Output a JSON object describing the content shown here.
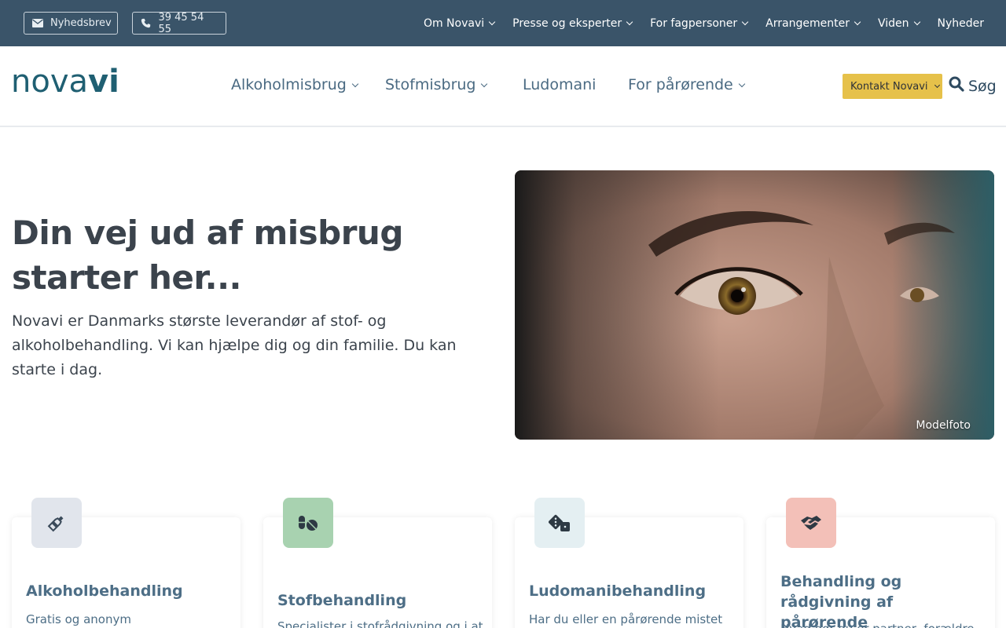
{
  "topbar": {
    "newsletter_label": "Nyhedsbrev",
    "phone_label": "39 45 54 55",
    "nav": [
      {
        "label": "Om Novavi"
      },
      {
        "label": "Presse og eksperter"
      },
      {
        "label": "For fagpersoner"
      },
      {
        "label": "Arrangementer"
      },
      {
        "label": "Viden"
      },
      {
        "label": "Nyheder"
      }
    ]
  },
  "header": {
    "logo_text_a": "nova",
    "logo_text_b": "vi",
    "nav": [
      {
        "label": "Alkoholmisbrug"
      },
      {
        "label": "Stofmisbrug"
      },
      {
        "label": "Ludomani"
      },
      {
        "label": "For pårørende"
      }
    ],
    "contact_label": "Kontakt Novavi",
    "search_label": "Søg"
  },
  "hero": {
    "title": "Din vej ud af misbrug starter her...",
    "text": "Novavi er Danmarks største leverandør af stof- og alkoholbehandling. Vi kan hjælpe dig og din familie. Du kan starte i dag.",
    "image_credit": "Modelfoto"
  },
  "cards": [
    {
      "title": "Alkoholbehandling",
      "text": "Gratis og anonym",
      "icon": "bottle-icon",
      "color": "#e1e5ec"
    },
    {
      "title": "Stofbehandling",
      "text": "Specialister i stofrådgivning og i at",
      "icon": "pills-icon",
      "color": "#a8d2b0"
    },
    {
      "title": "Ludomanibehandling",
      "text": "Har du eller en pårørende mistet",
      "icon": "dice-icon",
      "color": "#e4eff2"
    },
    {
      "title": "Behandling og rådgivning af pårørende",
      "text": "Hvad gør du er partner, forældre",
      "icon": "handshake-icon",
      "color": "#f3c0b8"
    }
  ],
  "colors": {
    "topbar": "#3a5469",
    "accent": "#e6c14a",
    "brand": "#1f5f72"
  }
}
